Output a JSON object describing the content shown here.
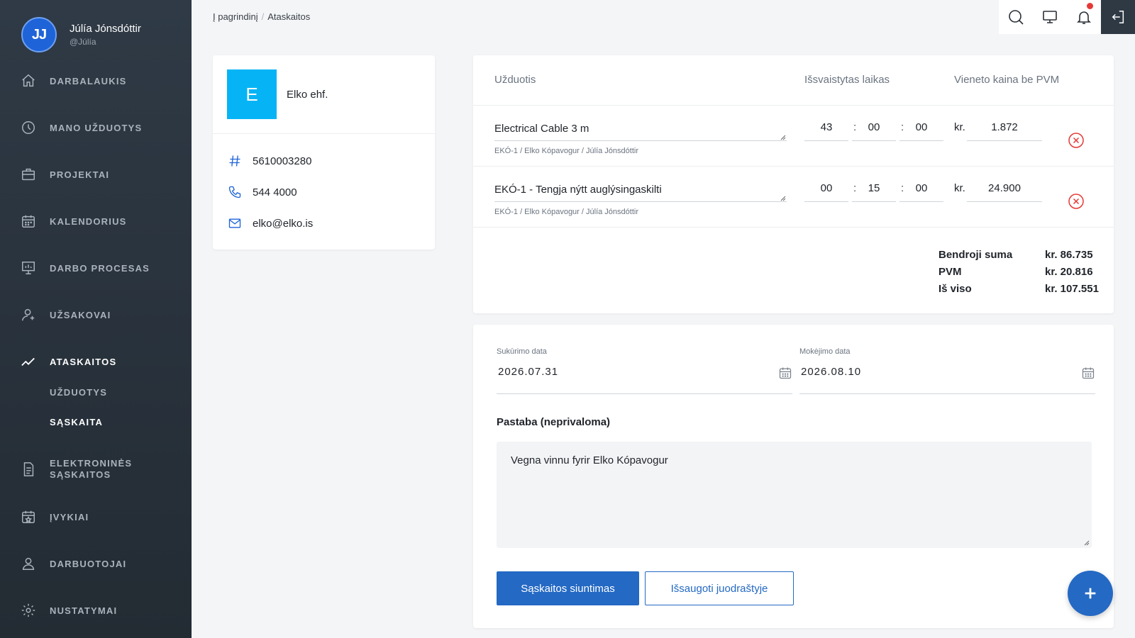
{
  "user": {
    "initials": "JJ",
    "name": "Júlía Jónsdóttir",
    "handle": "@Júlía"
  },
  "nav": {
    "items": [
      {
        "label": "DARBALAUKIS",
        "icon": "home-icon"
      },
      {
        "label": "MANO UŽDUOTYS",
        "icon": "clock-icon"
      },
      {
        "label": "PROJEKTAI",
        "icon": "briefcase-icon"
      },
      {
        "label": "KALENDORIUS",
        "icon": "calendar-icon"
      },
      {
        "label": "DARBO PROCESAS",
        "icon": "presentation-chart-icon"
      },
      {
        "label": "UŽSAKOVAI",
        "icon": "user-icon"
      },
      {
        "label": "ATASKAITOS",
        "icon": "trend-line-icon"
      },
      {
        "label": "ELEKTRONINĖS",
        "label2": "SĄSKAITOS",
        "icon": "document-icon"
      },
      {
        "label": "ĮVYKIAI",
        "icon": "calendar-star-icon"
      },
      {
        "label": "DARBUOTOJAI",
        "icon": "users-icon"
      },
      {
        "label": "NUSTATYMAI",
        "icon": "gear-icon"
      }
    ],
    "sub": [
      "UŽDUOTYS",
      "SĄSKAITA"
    ]
  },
  "breadcrumb": {
    "home": "Į pagrindinį",
    "current": "Ataskaitos"
  },
  "customer": {
    "logo_letter": "E",
    "name": "Elko ehf.",
    "id": "5610003280",
    "phone": "544 4000",
    "email": "elko@elko.is"
  },
  "items": {
    "headers": {
      "task": "Užduotis",
      "time": "Išsvaistytas laikas",
      "price": "Vieneto kaina be PVM"
    },
    "currency": "kr.",
    "rows": [
      {
        "task": "Electrical Cable 3 m",
        "sub": "EKÓ-1 / Elko Kópavogur / Júlía Jónsdóttir",
        "h": "43",
        "m": "00",
        "s": "00",
        "price": "1.872"
      },
      {
        "task": "EKÓ-1 - Tengja nýtt auglýsingaskilti",
        "sub": "EKÓ-1 / Elko Kópavogur / Júlía Jónsdóttir",
        "h": "00",
        "m": "15",
        "s": "00",
        "price": "24.900"
      }
    ],
    "totals": [
      {
        "label": "Bendroji suma",
        "value": "kr. 86.735"
      },
      {
        "label": "PVM",
        "value": "kr. 20.816"
      },
      {
        "label": "Iš viso",
        "value": "kr. 107.551"
      }
    ]
  },
  "invoice": {
    "created_label": "Sukūrimo data",
    "created_value": "2026.07.31",
    "due_label": "Mokėjimo data",
    "due_value": "2026.08.10",
    "note_label": "Pastaba (neprivaloma)",
    "note_value": "Vegna vinnu fyrir Elko Kópavogur",
    "send_button": "Sąskaitos siuntimas",
    "draft_button": "Išsaugoti juodraštyje"
  },
  "colors": {
    "accent": "#2469c4",
    "sidebar": "#2f3a46",
    "logo": "#06b4f5",
    "danger": "#e53935"
  }
}
